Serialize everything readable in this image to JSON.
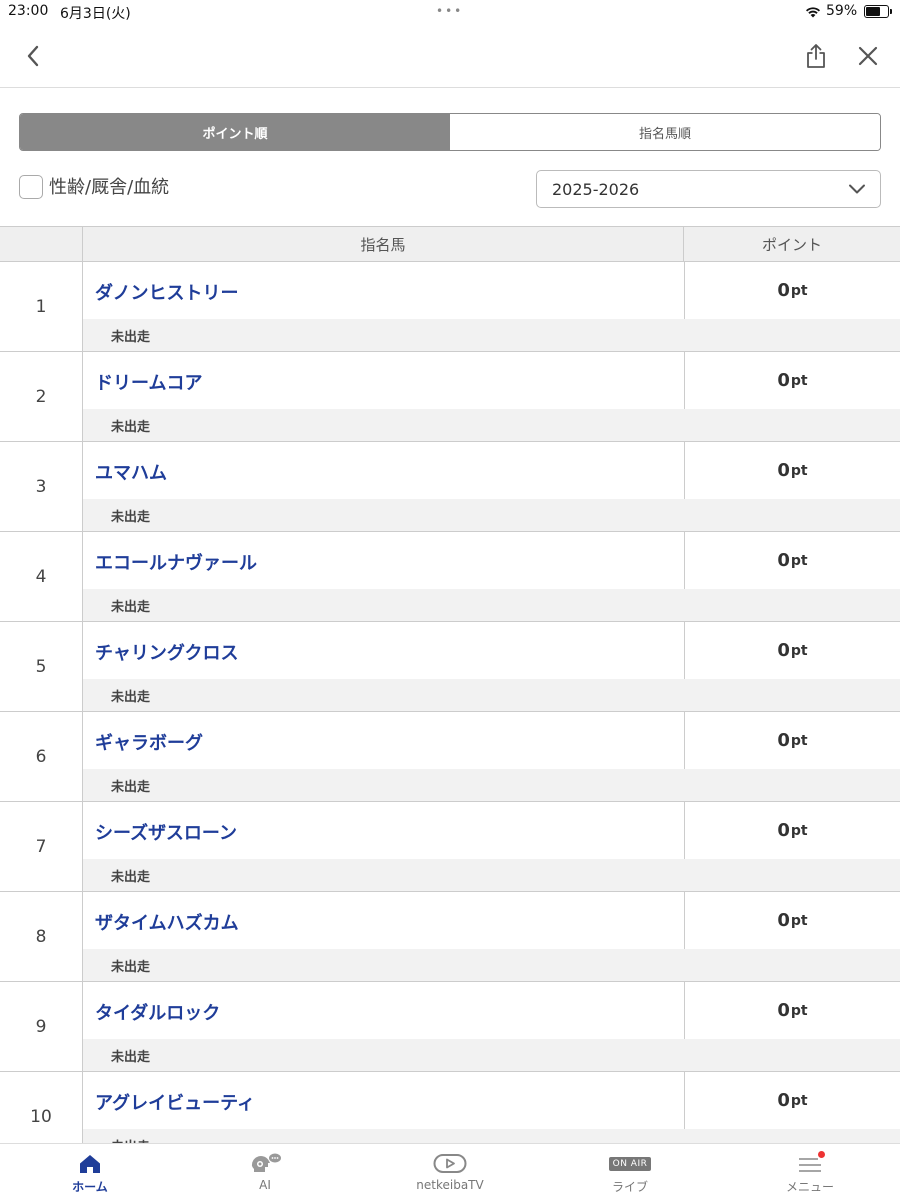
{
  "status_bar": {
    "time": "23:00",
    "date": "6月3日(火)",
    "dots": "•••",
    "battery": "59%"
  },
  "nav": {
    "back_icon": "chevron-left-icon",
    "share_icon": "share-icon",
    "close_icon": "close-icon"
  },
  "tabs": [
    {
      "label": "ポイント順",
      "active": true
    },
    {
      "label": "指名馬順",
      "active": false
    }
  ],
  "filter": {
    "checkbox_label": "性齢/厩舎/血統",
    "checked": false
  },
  "season_select": {
    "value": "2025-2026"
  },
  "table": {
    "headers": {
      "rank": "",
      "horse": "指名馬",
      "point": "ポイント"
    },
    "unit": "pt",
    "rows": [
      {
        "rank": "1",
        "name": "ダノンヒストリー",
        "points": "0",
        "status": "未出走"
      },
      {
        "rank": "2",
        "name": "ドリームコア",
        "points": "0",
        "status": "未出走"
      },
      {
        "rank": "3",
        "name": "ユマハム",
        "points": "0",
        "status": "未出走"
      },
      {
        "rank": "4",
        "name": "エコールナヴァール",
        "points": "0",
        "status": "未出走"
      },
      {
        "rank": "5",
        "name": "チャリングクロス",
        "points": "0",
        "status": "未出走"
      },
      {
        "rank": "6",
        "name": "ギャラボーグ",
        "points": "0",
        "status": "未出走"
      },
      {
        "rank": "7",
        "name": "シーズザスローン",
        "points": "0",
        "status": "未出走"
      },
      {
        "rank": "8",
        "name": "ザタイムハズカム",
        "points": "0",
        "status": "未出走"
      },
      {
        "rank": "9",
        "name": "タイダルロック",
        "points": "0",
        "status": "未出走"
      },
      {
        "rank": "10",
        "name": "アグレイビューティ",
        "points": "0",
        "status": "未出走"
      }
    ]
  },
  "tabbar": {
    "home": "ホーム",
    "ai": "AI",
    "tv": "netkeibaTV",
    "onair_badge": "ON AIR",
    "live": "ライブ",
    "menu": "メニュー"
  },
  "colors": {
    "accent": "#1f3d99",
    "tab_active": "#888888",
    "notification": "#ee3333"
  }
}
